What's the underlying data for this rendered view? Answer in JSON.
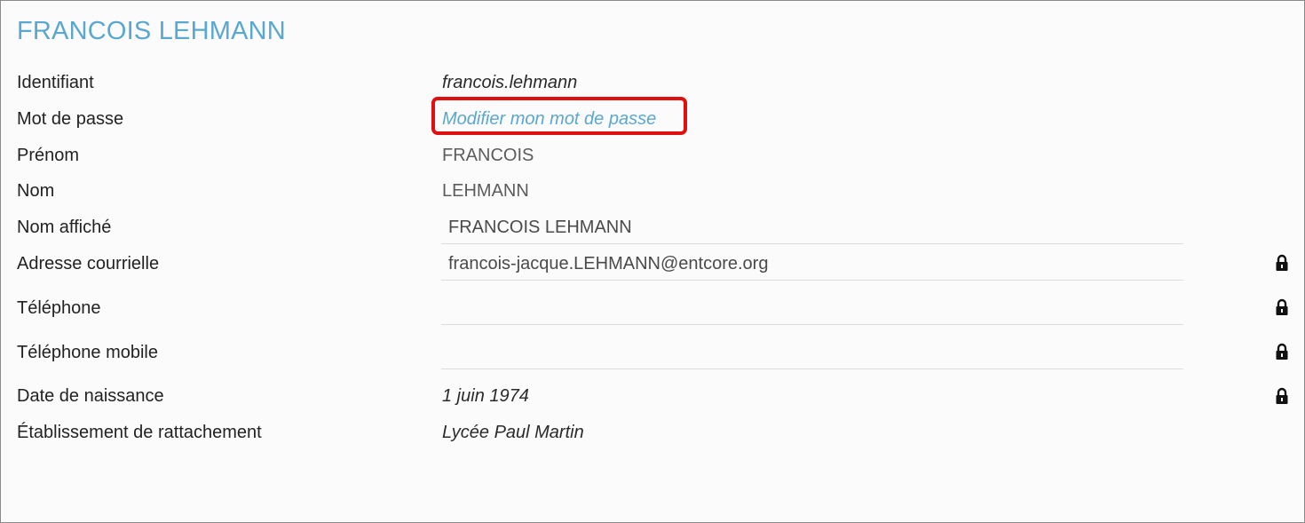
{
  "profile": {
    "title": "FRANCOIS LEHMANN",
    "rows": {
      "identifiant": {
        "label": "Identifiant",
        "value": "francois.lehmann"
      },
      "mot_de_passe": {
        "label": "Mot de passe",
        "link": "Modifier mon mot de passe"
      },
      "prenom": {
        "label": "Prénom",
        "value": "FRANCOIS"
      },
      "nom": {
        "label": "Nom",
        "value": "LEHMANN"
      },
      "nom_affiche": {
        "label": "Nom affiché",
        "value": "FRANCOIS LEHMANN"
      },
      "adresse": {
        "label": "Adresse courrielle",
        "value": "francois-jacque.LEHMANN@entcore.org",
        "locked": true
      },
      "telephone": {
        "label": "Téléphone",
        "value": "",
        "locked": true
      },
      "mobile": {
        "label": "Téléphone mobile",
        "value": "",
        "locked": true
      },
      "naissance": {
        "label": "Date de naissance",
        "value": "1 juin 1974",
        "locked": true
      },
      "etablissement": {
        "label": "Établissement de rattachement",
        "value": "Lycée Paul Martin"
      }
    }
  },
  "icons": {
    "lock": "lock-icon"
  },
  "colors": {
    "title": "#5aa7cf",
    "link": "#5aa7cf",
    "highlight": "#e01010"
  }
}
